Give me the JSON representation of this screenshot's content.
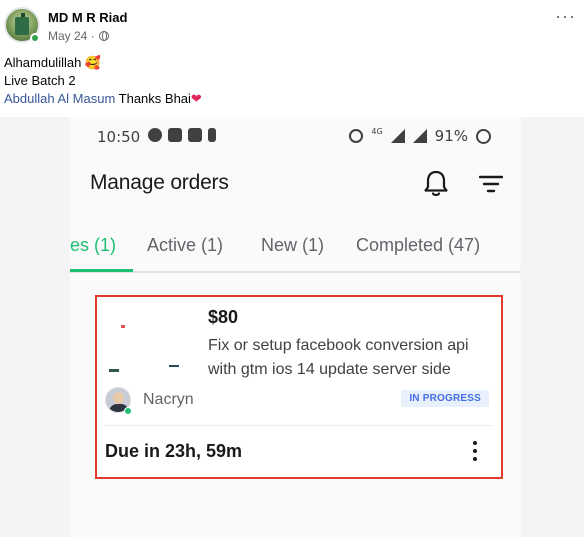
{
  "post": {
    "author": "MD M R Riad",
    "date": "May 24 ·",
    "more": "···",
    "text_line1": "Alhamdulillah 🥰",
    "text_line2": "Live Batch 2",
    "mention": "Abdullah Al Masum",
    "text_line3_tail": " Thanks Bhai",
    "heart": "❤"
  },
  "phone": {
    "status_time": "10:50",
    "network": "4G",
    "battery": "91%",
    "page_title": "Manage orders",
    "tabs": [
      {
        "label": "es (1)",
        "active": true
      },
      {
        "label": "Active (1)",
        "active": false
      },
      {
        "label": "New (1)",
        "active": false
      },
      {
        "label": "Completed (47)",
        "active": false
      }
    ],
    "order": {
      "price": "$80",
      "title": "Fix or setup facebook conversion api with gtm ios 14 update server side",
      "buyer": "Nacryn",
      "status": "IN PROGRESS",
      "due": "Due in 23h, 59m"
    }
  },
  "colors": {
    "accent": "#1dbf73",
    "highlight_border": "#e03a2f",
    "badge_text": "#446ee7",
    "fb_link": "#385898"
  }
}
